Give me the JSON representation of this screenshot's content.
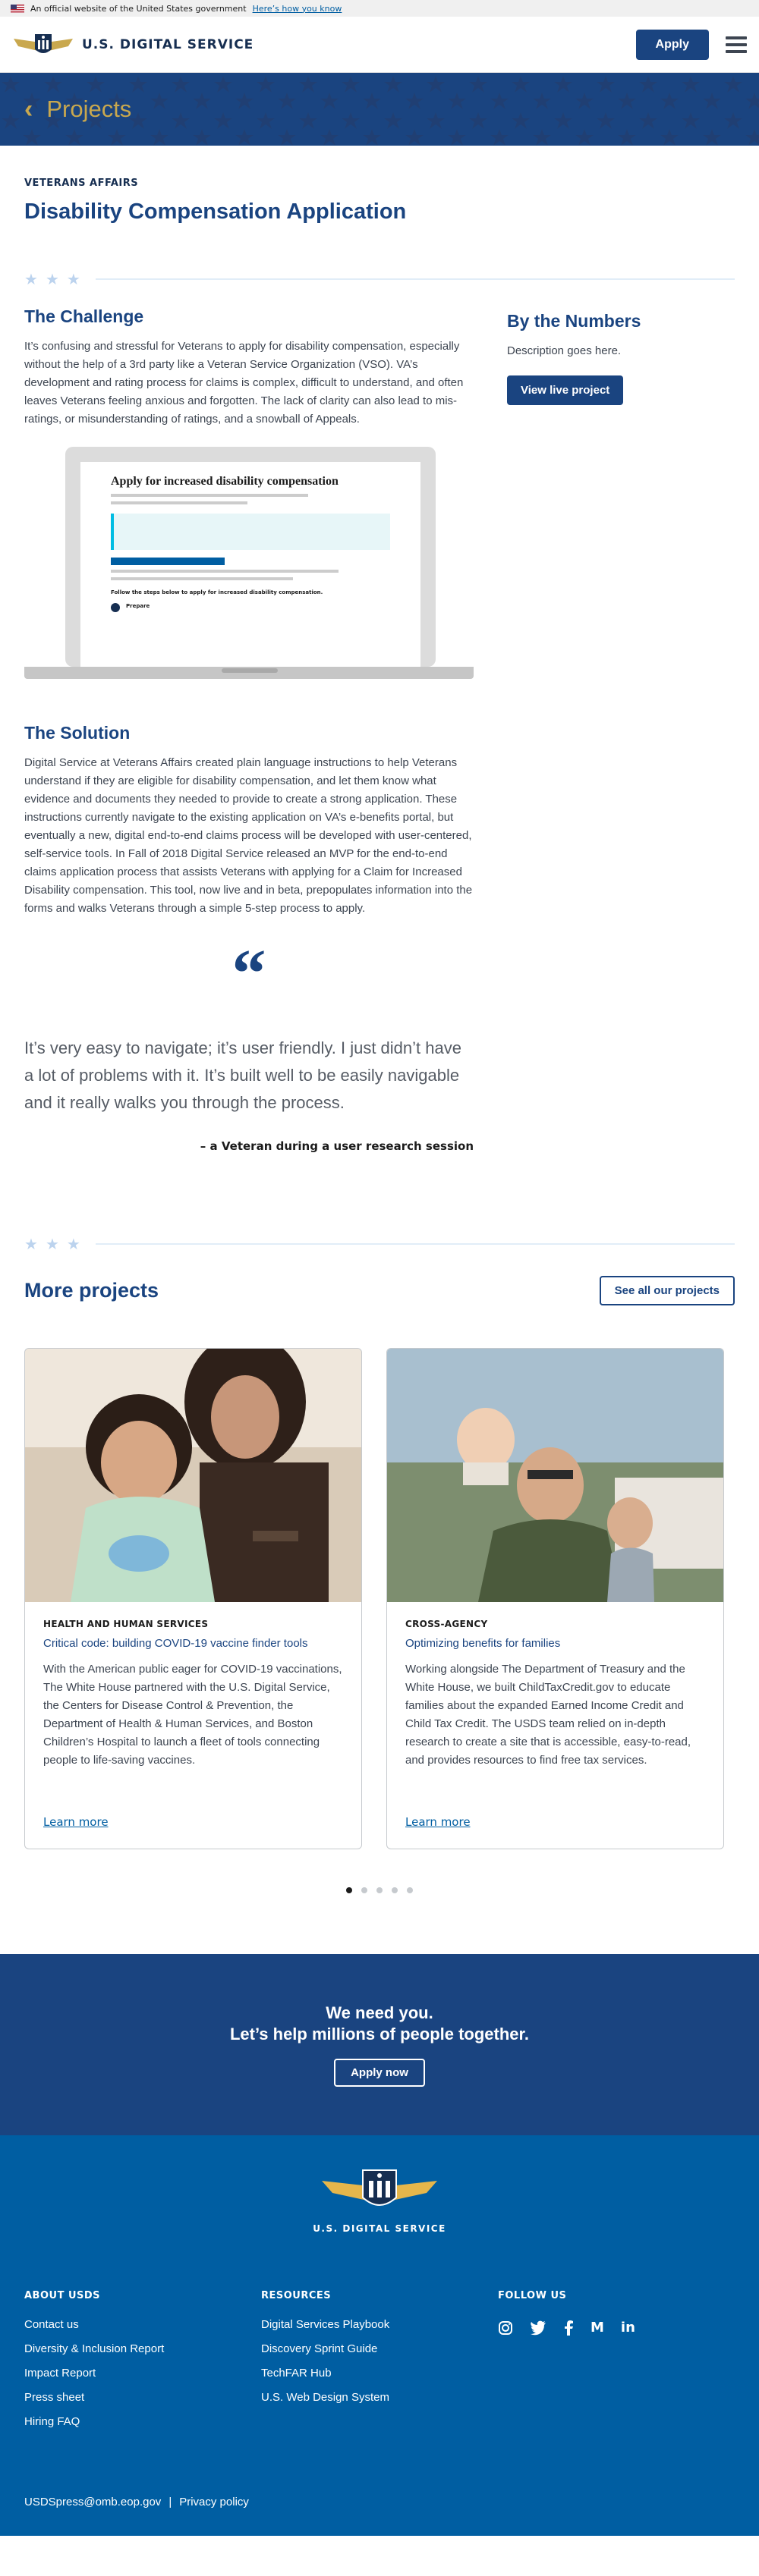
{
  "gov_banner": {
    "text": "An official website of the United States government",
    "link": "Here’s how you know"
  },
  "header": {
    "logo_text": "U.S. DIGITAL SERVICE",
    "apply_label": "Apply"
  },
  "hero": {
    "title": "Projects"
  },
  "page": {
    "eyebrow": "VETERANS AFFAIRS",
    "title": "Disability Compensation Application"
  },
  "challenge": {
    "heading": "The Challenge",
    "body": "It’s confusing and stressful for Veterans to apply for disability compensation, especially without the help of a 3rd party like a Veteran Service Organization (VSO). VA’s development and rating process for claims is complex, difficult to understand, and often leaves Veterans feeling anxious and forgotten. The lack of clarity can also lead to mis-ratings, or misunderstanding of ratings, and a snowball of Appeals."
  },
  "numbers": {
    "heading": "By the Numbers",
    "description": "Description goes here.",
    "button": "View live project"
  },
  "screenshot": {
    "title": "Apply for increased disability compensation",
    "subheading": "Follow the steps below to apply for increased disability compensation.",
    "step": "Prepare"
  },
  "solution": {
    "heading": "The Solution",
    "body": "Digital Service at Veterans Affairs created plain language instructions to help Veterans understand if they are eligible for disability compensation, and let them know what evidence and documents they needed to provide to create a strong application. These instructions currently navigate to the existing application on VA’s e-benefits portal, but eventually a new, digital end-to-end claims process will be developed with user-centered, self-service tools. In Fall of 2018 Digital Service released an MVP for the end-to-end claims application process that assists Veterans with applying for a Claim for Increased Disability compensation. This tool, now live and in beta, prepopulates information into the forms and walks Veterans through a simple 5-step process to apply."
  },
  "quote": {
    "mark": "“",
    "text": "It’s very easy to navigate; it’s user friendly. I just didn’t have a lot of problems with it. It’s built well to be easily navigable and it really walks you through the process.",
    "attribution": "– a Veteran during a user research session"
  },
  "more": {
    "heading": "More projects",
    "button": "See all our projects",
    "cards": [
      {
        "tag": "HEALTH AND HUMAN SERVICES",
        "title": "Critical code: building COVID-19 vaccine finder tools",
        "desc": "With the American public eager for COVID-19 vaccinations, The White House partnered with the U.S. Digital Service, the Centers for Disease Control & Prevention, the Department of Health & Human Services, and Boston Children’s Hospital to launch a fleet of tools connecting people to life-saving vaccines.",
        "link": "Learn more"
      },
      {
        "tag": "CROSS-AGENCY",
        "title": "Optimizing benefits for families",
        "desc": "Working alongside The Department of Treasury and the White House, we built ChildTaxCredit.gov to educate families about the expanded Earned Income Credit and Child Tax Credit. The USDS team relied on in-depth research to create a site that is accessible, easy-to-read, and provides resources to find free tax services.",
        "link": "Learn more"
      }
    ],
    "carousel": {
      "pages": 5,
      "active": 1
    }
  },
  "cta": {
    "line1": "We need you.",
    "line2": "Let’s help millions of people together.",
    "button": "Apply now"
  },
  "footer": {
    "logo_text": "U.S. DIGITAL SERVICE",
    "about": {
      "heading": "ABOUT USDS",
      "links": [
        "Contact us",
        "Diversity & Inclusion Report",
        "Impact Report",
        "Press sheet",
        "Hiring FAQ"
      ]
    },
    "resources": {
      "heading": "RESOURCES",
      "links": [
        "Digital Services Playbook",
        "Discovery Sprint Guide",
        "TechFAR Hub",
        "U.S. Web Design System"
      ]
    },
    "follow": {
      "heading": "FOLLOW US",
      "icons": [
        "instagram-icon",
        "twitter-icon",
        "facebook-icon",
        "medium-icon",
        "linkedin-icon"
      ]
    },
    "email": "USDSpress@omb.eop.gov",
    "separator": "|",
    "privacy": "Privacy policy"
  },
  "colors": {
    "primary": "#1a4480",
    "footer": "#005ea2",
    "gold": "#c9a84e"
  }
}
